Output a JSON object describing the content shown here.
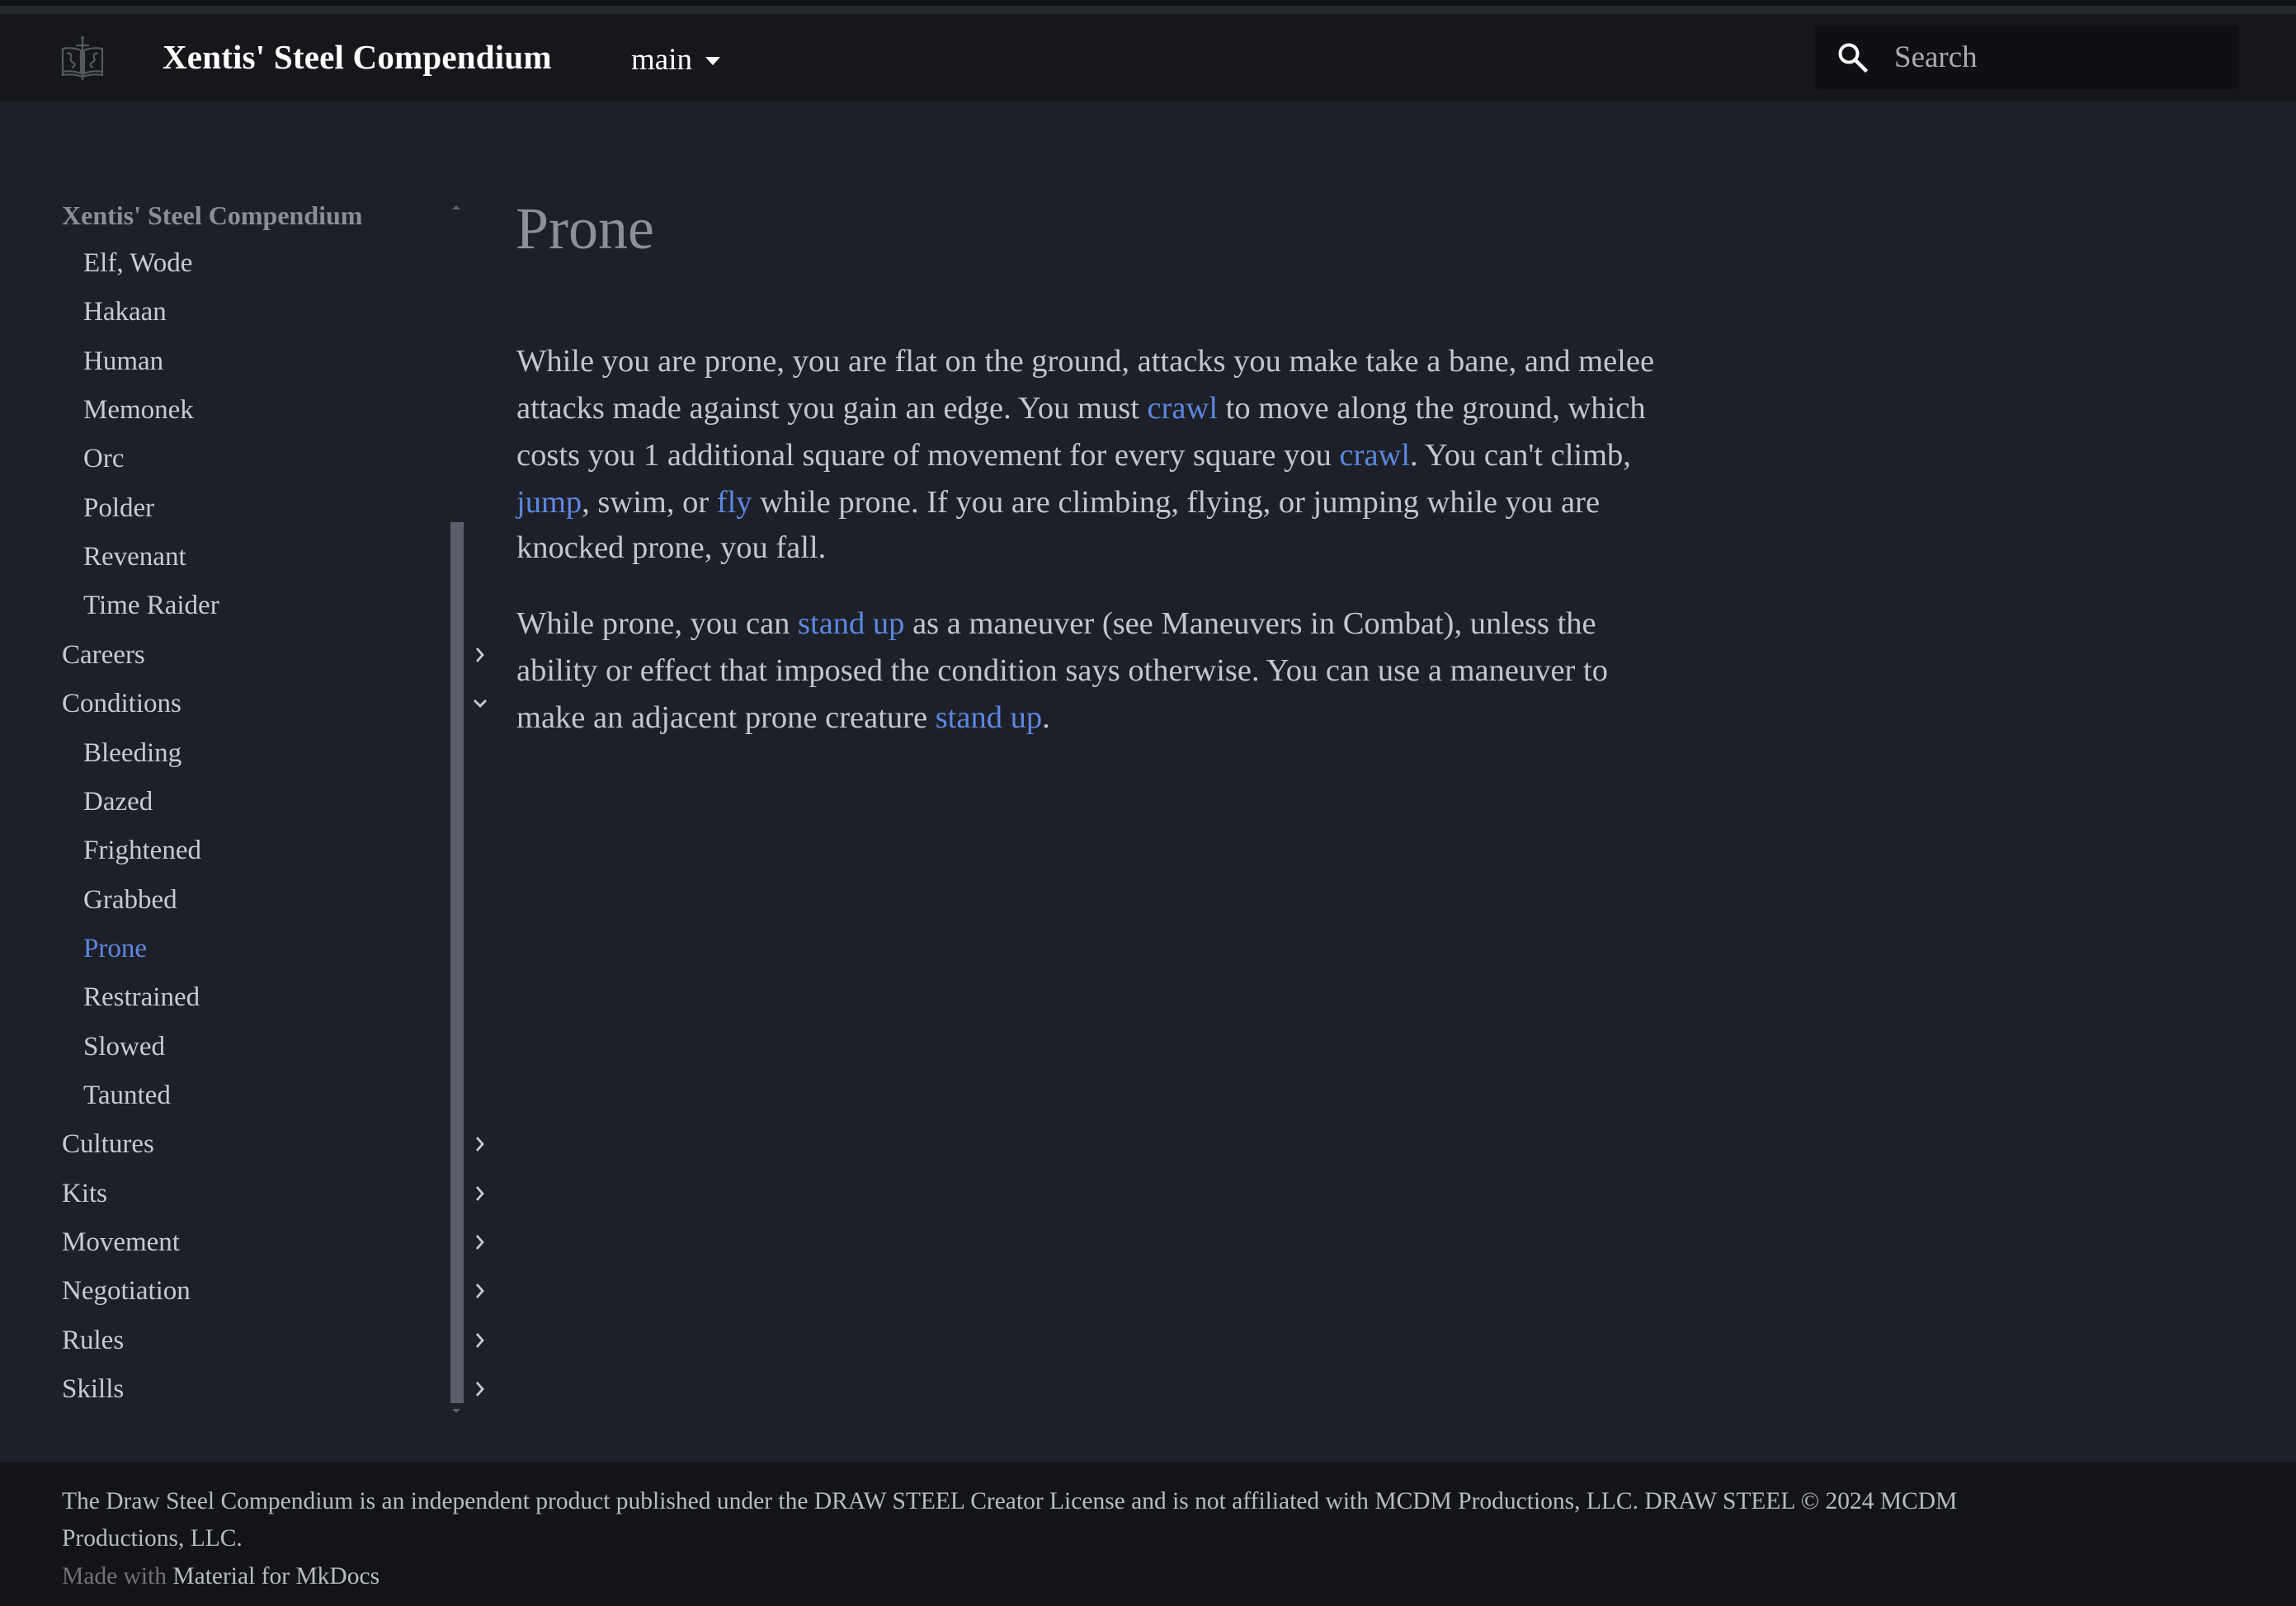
{
  "header": {
    "logo_icon": "book-sword-logo-icon",
    "site_title": "Xentis' Steel Compendium",
    "version_label": "main",
    "version_icon": "caret-down-icon",
    "search": {
      "placeholder": "Search",
      "value": "",
      "icon": "search-icon"
    }
  },
  "sidebar": {
    "title": "Xentis' Steel Compendium",
    "items": [
      {
        "label": "Elf, Wode",
        "type": "sub"
      },
      {
        "label": "Hakaan",
        "type": "sub"
      },
      {
        "label": "Human",
        "type": "sub"
      },
      {
        "label": "Memonek",
        "type": "sub"
      },
      {
        "label": "Orc",
        "type": "sub"
      },
      {
        "label": "Polder",
        "type": "sub"
      },
      {
        "label": "Revenant",
        "type": "sub"
      },
      {
        "label": "Time Raider",
        "type": "sub"
      },
      {
        "label": "Careers",
        "type": "section",
        "expanded": false
      },
      {
        "label": "Conditions",
        "type": "section",
        "expanded": true
      },
      {
        "label": "Bleeding",
        "type": "sub"
      },
      {
        "label": "Dazed",
        "type": "sub"
      },
      {
        "label": "Frightened",
        "type": "sub"
      },
      {
        "label": "Grabbed",
        "type": "sub"
      },
      {
        "label": "Prone",
        "type": "sub",
        "active": true
      },
      {
        "label": "Restrained",
        "type": "sub"
      },
      {
        "label": "Slowed",
        "type": "sub"
      },
      {
        "label": "Taunted",
        "type": "sub"
      },
      {
        "label": "Cultures",
        "type": "section",
        "expanded": false
      },
      {
        "label": "Kits",
        "type": "section",
        "expanded": false
      },
      {
        "label": "Movement",
        "type": "section",
        "expanded": false
      },
      {
        "label": "Negotiation",
        "type": "section",
        "expanded": false
      },
      {
        "label": "Rules",
        "type": "section",
        "expanded": false
      },
      {
        "label": "Skills",
        "type": "section",
        "expanded": false
      }
    ]
  },
  "content": {
    "title": "Prone",
    "paragraphs": [
      [
        [
          {
            "text": "While you are prone, you are flat on the ground, attacks you make take a bane, and melee"
          }
        ],
        [
          {
            "text": "attacks made against you gain an edge. You must "
          },
          {
            "text": "crawl",
            "link": true
          },
          {
            "text": " to move along the ground, which"
          }
        ],
        [
          {
            "text": "costs you 1 additional square of movement for every square you "
          },
          {
            "text": "crawl",
            "link": true
          },
          {
            "text": ". You can't climb,"
          }
        ],
        [
          {
            "text": "jump",
            "link": true
          },
          {
            "text": ", swim, or "
          },
          {
            "text": "fly",
            "link": true
          },
          {
            "text": " while prone. If you are climbing, flying, or jumping while you are"
          }
        ],
        [
          {
            "text": "knocked prone, you fall."
          }
        ]
      ],
      [
        [
          {
            "text": "While prone, you can "
          },
          {
            "text": "stand up",
            "link": true
          },
          {
            "text": " as a maneuver (see Maneuvers in Combat), unless the"
          }
        ],
        [
          {
            "text": "ability or effect that imposed the condition says otherwise. You can use a maneuver to"
          }
        ],
        [
          {
            "text": "make an adjacent prone creature "
          },
          {
            "text": "stand up",
            "link": true
          },
          {
            "text": "."
          }
        ]
      ]
    ]
  },
  "footer": {
    "license_line_1": "The Draw Steel Compendium is an independent product published under the DRAW STEEL Creator License and is not affiliated with MCDM Productions, LLC. DRAW STEEL © 2024 MCDM",
    "license_line_2": "Productions, LLC.",
    "made_with_prefix": "Made with",
    "made_with_link": "Material for MkDocs"
  },
  "colors": {
    "background": "#1e2029",
    "header": "#16171b",
    "footer": "#131418",
    "accent_link": "#5b88df",
    "text": "#c3c6cd",
    "title_muted": "#8c8f98"
  }
}
